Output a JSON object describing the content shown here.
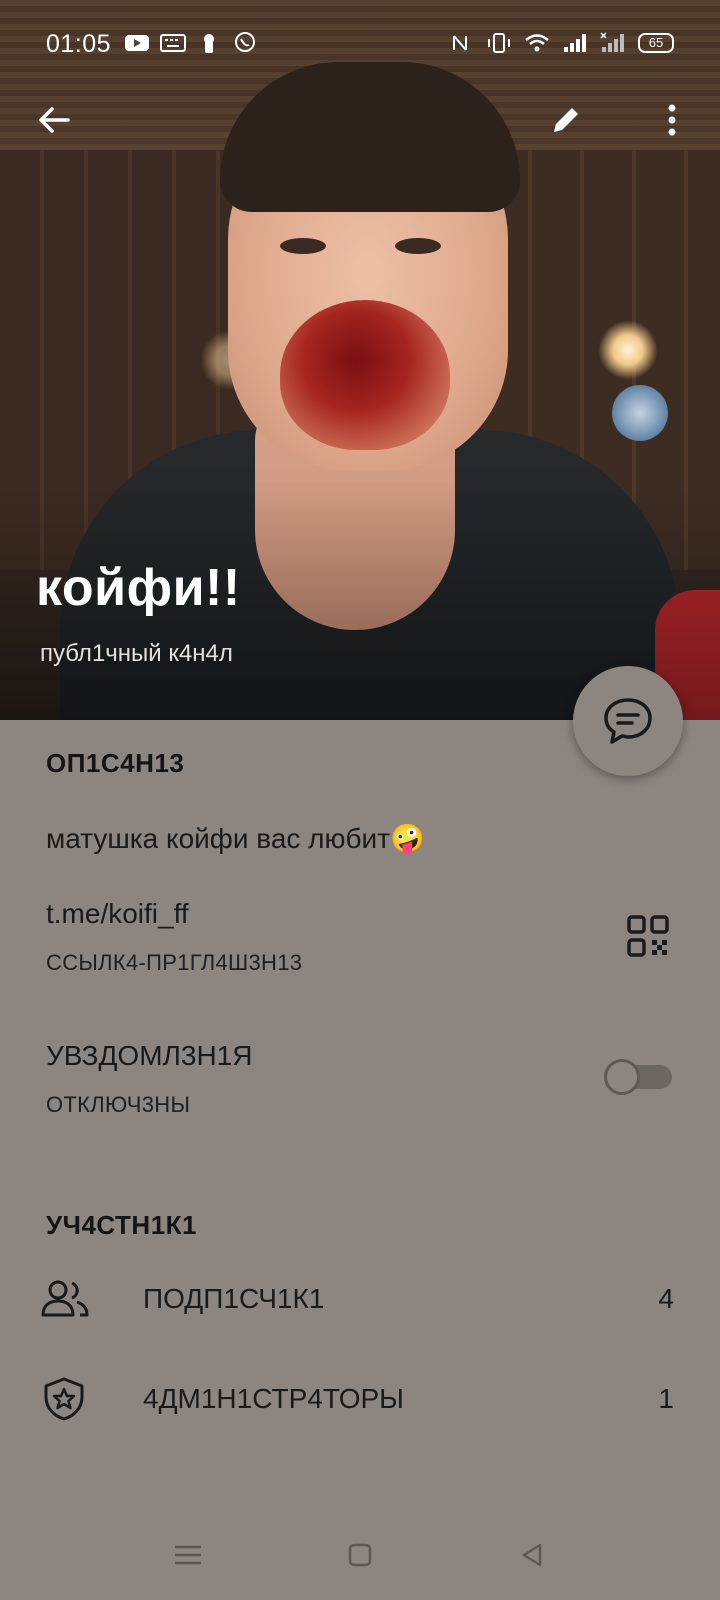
{
  "status_bar": {
    "time": "01:05",
    "battery": "65",
    "left_icons": [
      "youtube-icon",
      "keyboard-icon",
      "keyhole-icon",
      "viber-icon"
    ],
    "right_icons": [
      "nfc-icon",
      "vibrate-icon",
      "wifi-icon",
      "signal-icon",
      "signal-x-icon",
      "battery-icon"
    ]
  },
  "header": {
    "title": "койфи!!",
    "subtitle": "публ1чный к4н4л"
  },
  "description": {
    "heading": "ОП1С4Н13",
    "text": "матушка койфи вас любит🤪"
  },
  "link": {
    "url": "t.me/koifi_ff",
    "label": "ССЫЛК4-ПР1ГЛ4Ш3Н13"
  },
  "notifications": {
    "title": "УВЗДОМЛ3Н1Я",
    "state": "ОТКЛЮЧ3НЫ",
    "enabled": false
  },
  "members": {
    "heading": "УЧ4СТН1К1",
    "rows": [
      {
        "icon": "people-icon",
        "label": "ПОДП1СЧ1К1",
        "count": "4"
      },
      {
        "icon": "admin-shield-icon",
        "label": "4ДМ1Н1СТР4ТОРЫ",
        "count": "1"
      }
    ]
  },
  "colors": {
    "background": "#8c8580",
    "text": "#1a1a1a",
    "header_text": "#ffffff"
  }
}
